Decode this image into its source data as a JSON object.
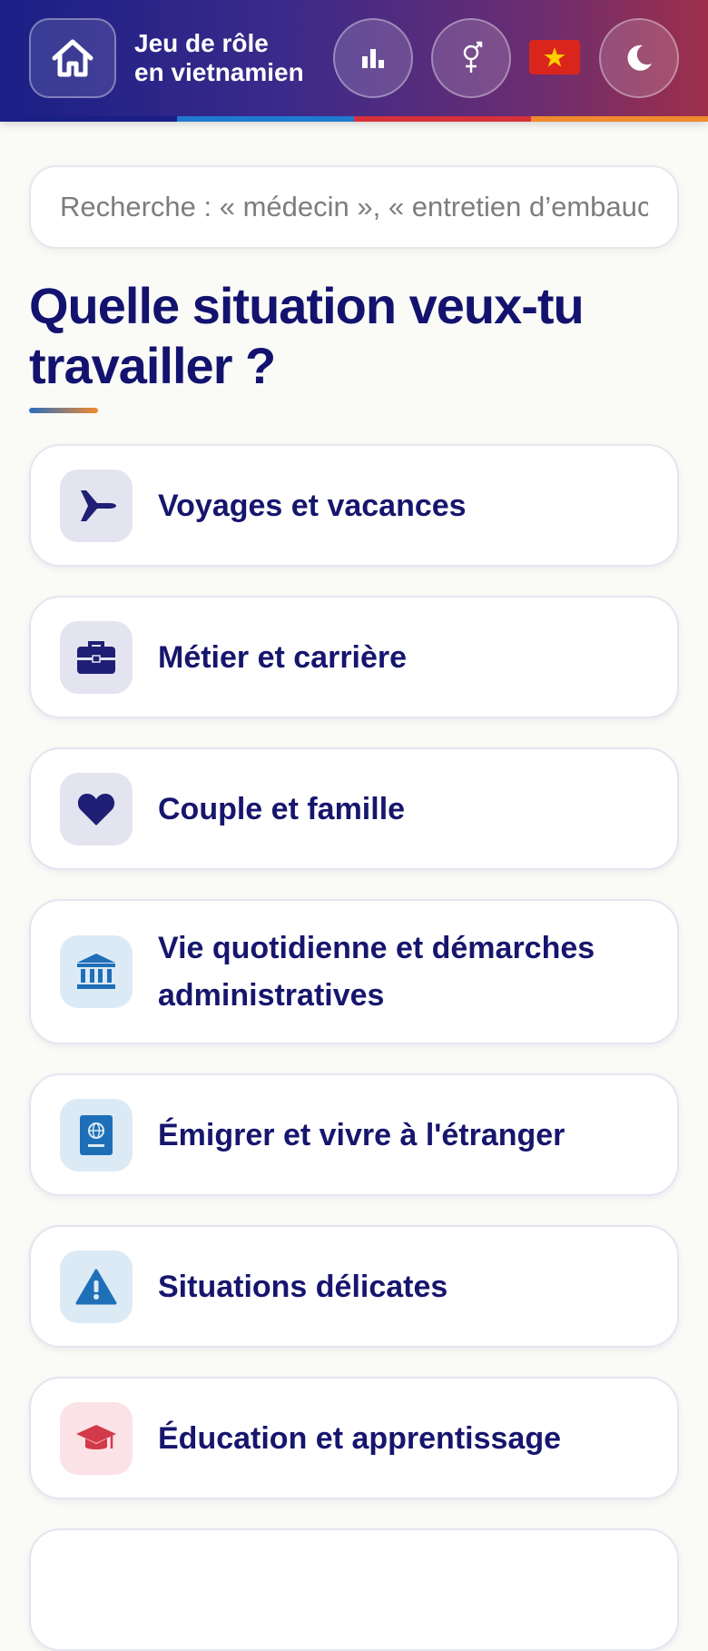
{
  "header": {
    "title_line1": "Jeu de rôle",
    "title_line2": "en vietnamien",
    "buttons": [
      {
        "icon": "home-icon"
      },
      {
        "icon": "bar-chart-icon"
      },
      {
        "icon": "gender-icon"
      },
      {
        "icon": "vietnam-flag-icon"
      },
      {
        "icon": "moon-icon"
      }
    ],
    "stripe_colors": [
      "#1a1f86",
      "#1f7ad1",
      "#d8303a",
      "#f08a2c"
    ]
  },
  "search": {
    "placeholder": "Recherche : « médecin », « entretien d’embauche »",
    "value": ""
  },
  "main": {
    "question": "Quelle situation veux-tu travailler ?",
    "categories": [
      {
        "label": "Voyages et vacances",
        "icon": "airplane-icon",
        "icon_bg": "#e4e4f0",
        "icon_color": "#1f1f75"
      },
      {
        "label": "Métier et carrière",
        "icon": "briefcase-icon",
        "icon_bg": "#e4e4f0",
        "icon_color": "#1f1f75"
      },
      {
        "label": "Couple et famille",
        "icon": "heart-icon",
        "icon_bg": "#e4e4f0",
        "icon_color": "#1f1f75"
      },
      {
        "label": "Vie quotidienne et démarches administratives",
        "icon": "government-building-icon",
        "icon_bg": "#dceaf6",
        "icon_color": "#1f6fb8"
      },
      {
        "label": "Émigrer et vivre à l'étranger",
        "icon": "passport-icon",
        "icon_bg": "#dceaf6",
        "icon_color": "#1f6fb8"
      },
      {
        "label": "Situations délicates",
        "icon": "warning-icon",
        "icon_bg": "#dceaf6",
        "icon_color": "#1f6fb8"
      },
      {
        "label": "Éducation et apprentissage",
        "icon": "graduation-cap-icon",
        "icon_bg": "#fbe2e6",
        "icon_color": "#d23a4a"
      }
    ]
  }
}
